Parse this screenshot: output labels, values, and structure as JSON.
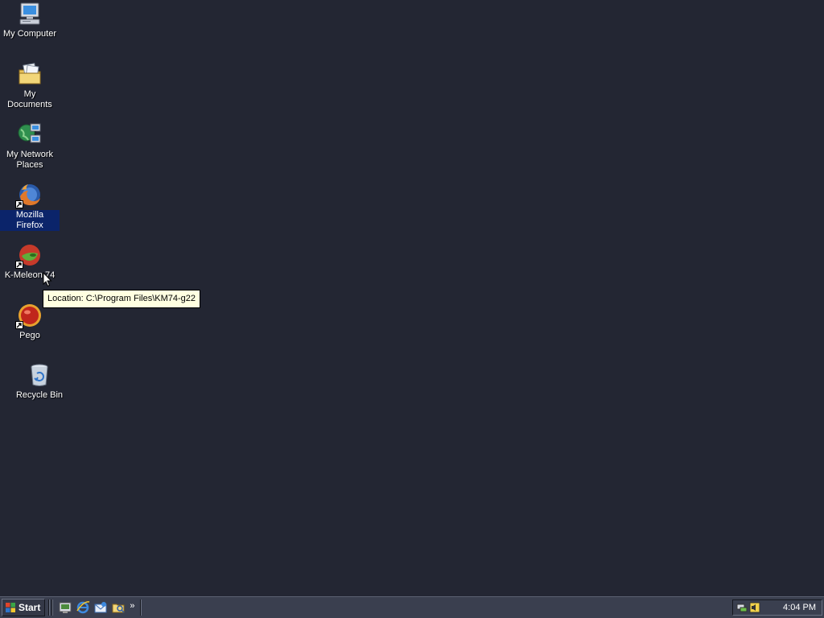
{
  "desktop": {
    "icons": [
      {
        "label": "My Computer",
        "icon": "my-computer-icon"
      },
      {
        "label": "My Documents",
        "icon": "my-documents-icon"
      },
      {
        "label": "My Network Places",
        "icon": "my-network-places-icon"
      },
      {
        "label": "Mozilla Firefox",
        "icon": "firefox-icon",
        "selected": true,
        "shortcut": true
      },
      {
        "label": "K-Meleon 74",
        "icon": "k-meleon-icon",
        "shortcut": true
      },
      {
        "label": "Pego",
        "icon": "pego-icon",
        "shortcut": true
      },
      {
        "label": "Recycle Bin",
        "icon": "recycle-bin-icon"
      }
    ],
    "tooltip": "Location: C:\\Program Files\\KM74-g22",
    "background_color": "#232633"
  },
  "taskbar": {
    "start_label": "Start",
    "quick_launch": [
      "show-desktop-icon",
      "internet-explorer-icon",
      "outlook-express-icon",
      "windows-explorer-icon"
    ],
    "more_label": "»",
    "tray_icons": [
      "network-icon",
      "volume-icon"
    ],
    "clock": "4:04 PM"
  }
}
